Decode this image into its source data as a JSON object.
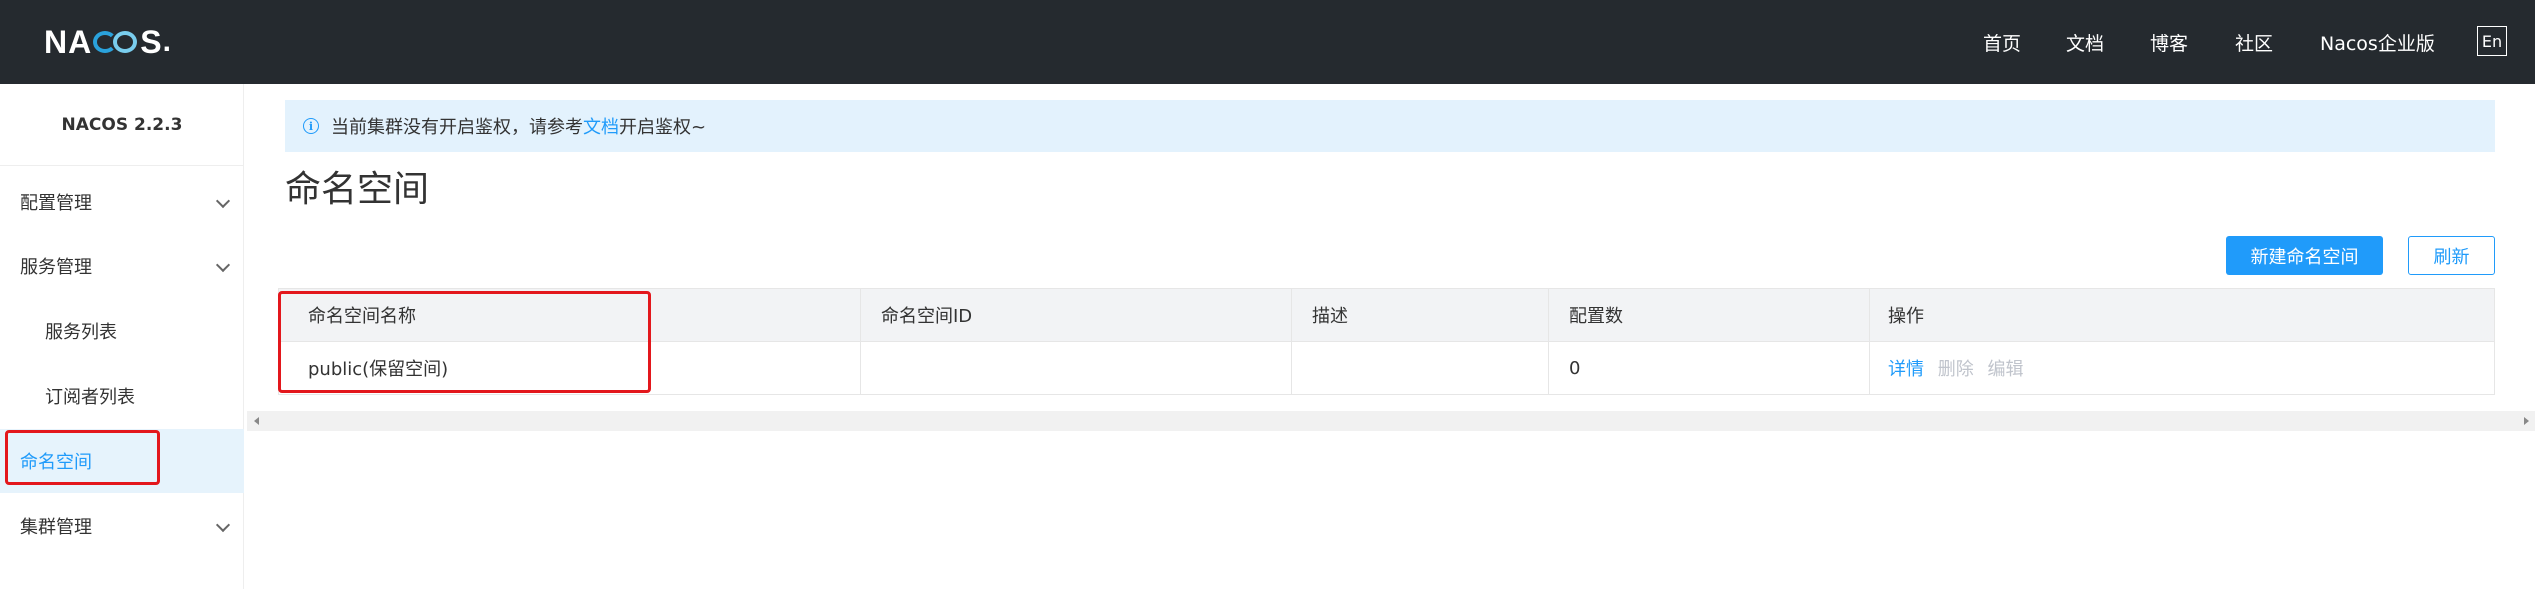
{
  "header": {
    "logo_text": "NACOS",
    "nav": [
      "首页",
      "文档",
      "博客",
      "社区",
      "Nacos企业版"
    ],
    "lang": "En"
  },
  "sidebar": {
    "version": "NACOS 2.2.3",
    "items": [
      {
        "label": "配置管理"
      },
      {
        "label": "服务管理"
      },
      {
        "label": "服务列表"
      },
      {
        "label": "订阅者列表"
      },
      {
        "label": "命名空间"
      },
      {
        "label": "集群管理"
      }
    ]
  },
  "notice": {
    "prefix": "当前集群没有开启鉴权，请参考",
    "link": "文档",
    "suffix": "开启鉴权~"
  },
  "page": {
    "title": "命名空间",
    "new_button": "新建命名空间",
    "refresh_button": "刷新"
  },
  "table": {
    "columns": [
      "命名空间名称",
      "命名空间ID",
      "描述",
      "配置数",
      "操作"
    ],
    "rows": [
      {
        "name": "public(保留空间)",
        "id": "",
        "desc": "",
        "count": "0",
        "ops": [
          "详情",
          "删除",
          "编辑"
        ]
      }
    ]
  },
  "colors": {
    "accent": "#209bfa",
    "topbar": "#252a2f",
    "highlight_border": "#e3171c"
  }
}
